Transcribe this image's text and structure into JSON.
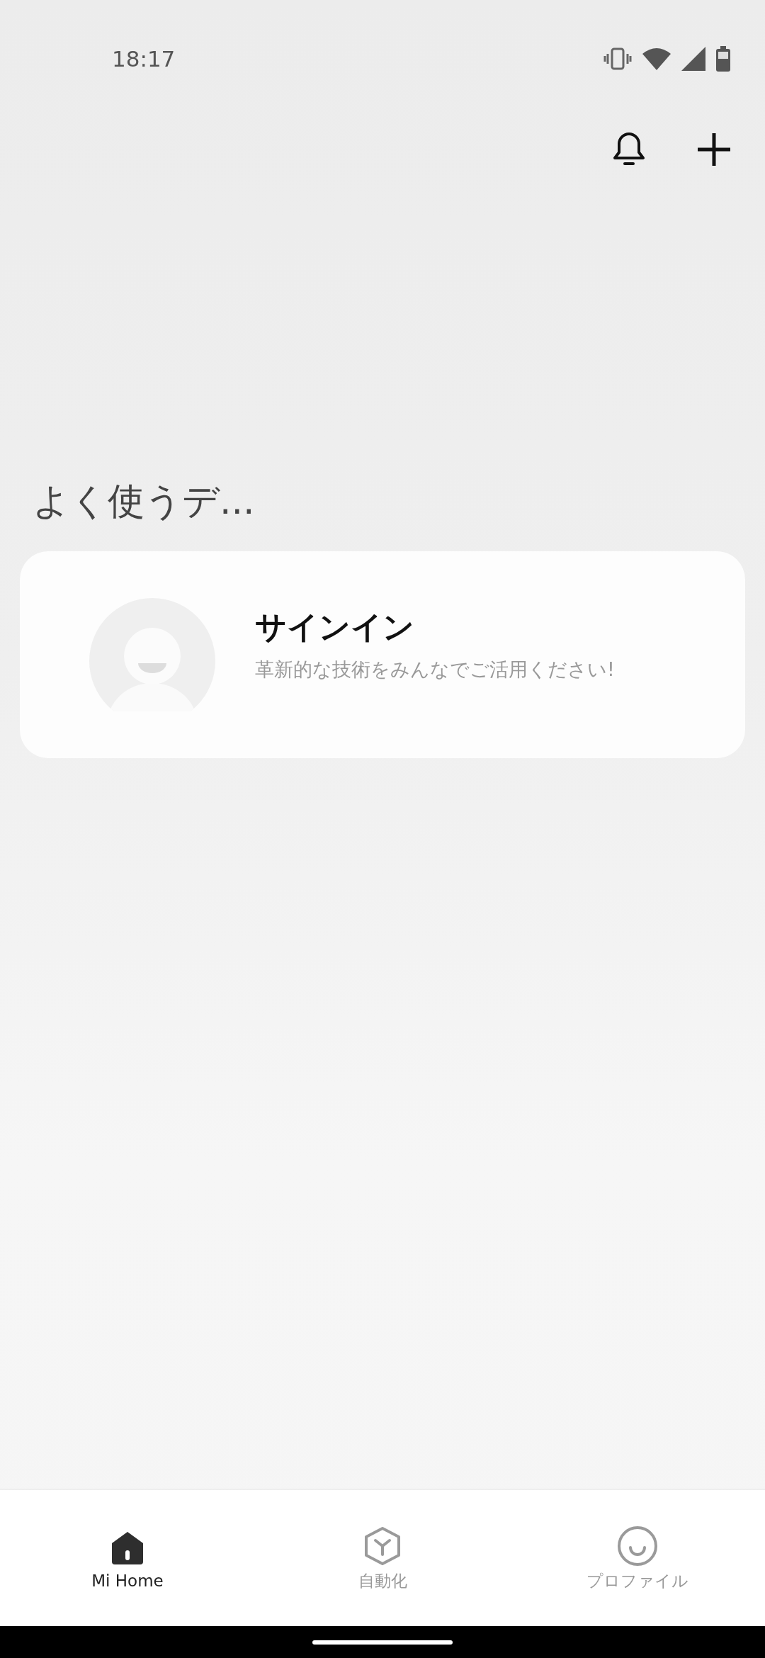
{
  "status_bar": {
    "time": "18:17"
  },
  "section": {
    "title": "よく使うデ..."
  },
  "sign_in_card": {
    "title": "サインイン",
    "subtitle": "革新的な技術をみんなでご活用ください!"
  },
  "tabs": [
    {
      "label": "Mi Home",
      "kind": "home",
      "selected": true
    },
    {
      "label": "自動化",
      "kind": "automation",
      "selected": false
    },
    {
      "label": "プロファイル",
      "kind": "profile",
      "selected": false
    }
  ]
}
